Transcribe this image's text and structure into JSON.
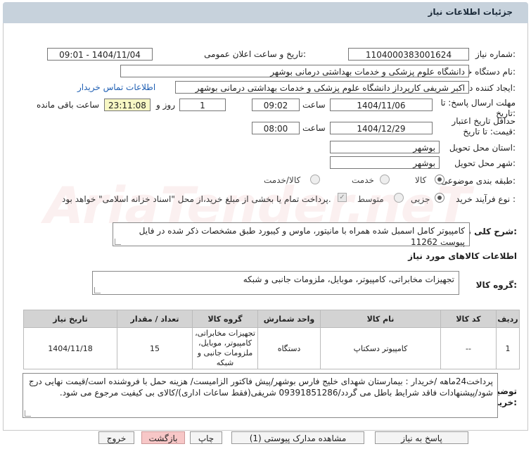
{
  "header": {
    "title": "جزئیات اطلاعات نیاز"
  },
  "fields": {
    "need_number_label": "شماره نیاز:",
    "need_number": "1104000383001624",
    "announce_label": "تاریخ و ساعت اعلان عمومی:",
    "announce_value": "1404/11/04 - 09:01",
    "buyer_org_label": "نام دستگاه خریدار:",
    "buyer_org": "دانشگاه علوم پزشکی و خدمات بهداشتی درمانی بوشهر",
    "requester_label": "ایجاد کننده درخواست:",
    "requester": "اکبر شریفی کارپرداز دانشگاه علوم پزشکی و خدمات بهداشتی درمانی بوشهر",
    "contact_link": "اطلاعات تماس خریدار",
    "deadline_label": "مهلت ارسال پاسخ: تا تاریخ:",
    "deadline_date": "1404/11/06",
    "time_label": "ساعت",
    "deadline_time": "09:02",
    "days_value": "1",
    "days_label": "روز و",
    "remaining_time": "23:11:08",
    "remaining_label": "ساعت باقی مانده",
    "validity_label": "حداقل تاریخ اعتبار قیمت: تا تاریخ:",
    "validity_date": "1404/12/29",
    "validity_time": "08:00",
    "province_label": "استان محل تحویل:",
    "province": "بوشهر",
    "city_label": "شهر محل تحویل:",
    "city": "بوشهر",
    "category_label": "طبقه بندی موضوعی:",
    "category_options": [
      "کالا",
      "خدمت",
      "کالا/خدمت"
    ],
    "process_label": "نوع فرآیند خرید :",
    "process_options": [
      "جزیی",
      "متوسط"
    ],
    "payment_note": "پرداخت تمام یا بخشی از مبلغ خرید،از محل \"اسناد خزانه اسلامی\" خواهد بود."
  },
  "summary": {
    "label": "شرح کلی نیاز:",
    "text": "کامپیوتر کامل اسمبل شده همراه با مانیتور، ماوس و کیبورد طبق مشخصات ذکر شده در فایل پیوست 11262"
  },
  "goods_section": {
    "title": "اطلاعات کالاهای مورد نیاز",
    "group_label": "گروه کالا:",
    "group_value": "تجهیزات مخابراتی، کامپیوتر، موبایل، ملزومات جانبی و شبکه"
  },
  "table": {
    "headers": [
      "ردیف",
      "کد کالا",
      "نام کالا",
      "واحد شمارش",
      "گروه کالا",
      "تعداد / مقدار",
      "تاریخ نیاز"
    ],
    "rows": [
      [
        "1",
        "--",
        "کامپیوتر دسکتاپ",
        "دستگاه",
        "تجهیزات مخابراتی، کامپیوتر، موبایل، ملزومات جانبی و شبکه",
        "15",
        "1404/11/18"
      ]
    ]
  },
  "buyer_notes": {
    "label": "توضیحات خریدار:",
    "text": "پرداخت24ماهه /خریدار : بیمارستان شهدای خلیج فارس بوشهر/پیش فاکتور الزامیست/ هزینه حمل با فروشنده است/قیمت نهایی درج شود/پیشنهادات فاقد شرایط باطل می گردد/09391851286 شریفی(فقط ساعات اداری)/کالای بی کیفیت مرجوع می شود."
  },
  "buttons": {
    "reply": "پاسخ به نیاز",
    "attachments": "مشاهده مدارک پیوستی (1)",
    "print": "چاپ",
    "back": "بازگشت",
    "exit": "خروج"
  },
  "colors": {
    "header_bg": "#c7d2dc",
    "table_header_bg": "#d3d3d3",
    "remaining_bg": "#f7f7c4",
    "link": "#1f5fb3",
    "exit_bg": "#f7c7c7"
  }
}
